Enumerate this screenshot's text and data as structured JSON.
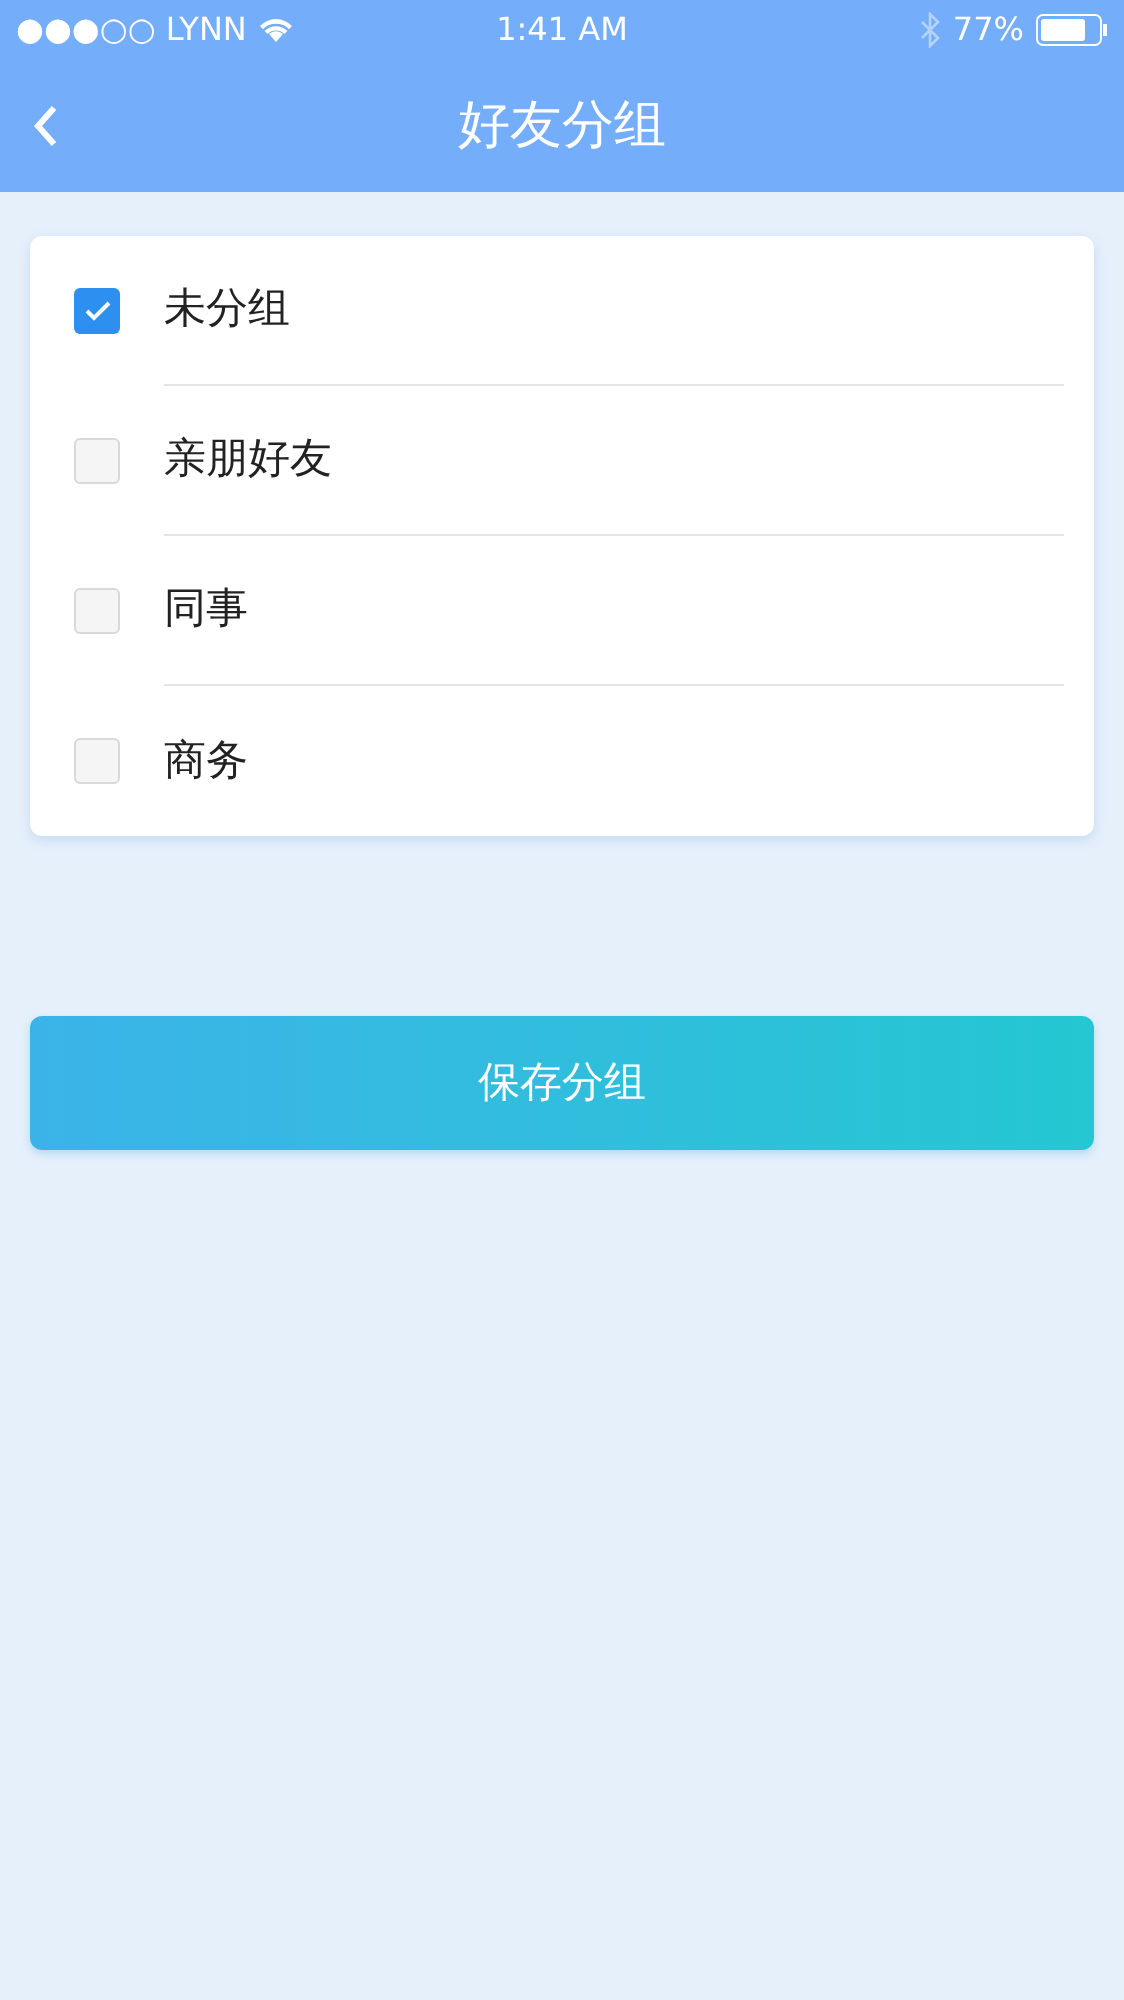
{
  "status_bar": {
    "carrier": "●●●○○ LYNN",
    "time": "1:41 AM",
    "battery": "77%"
  },
  "nav_bar": {
    "title": "好友分组"
  },
  "groups": [
    {
      "label": "未分组",
      "checked": true
    },
    {
      "label": "亲朋好友",
      "checked": false
    },
    {
      "label": "同事",
      "checked": false
    },
    {
      "label": "商务",
      "checked": false
    }
  ],
  "save_button": "保存分组"
}
